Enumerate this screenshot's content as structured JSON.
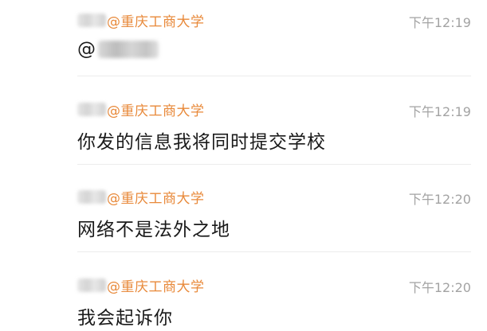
{
  "messages": [
    {
      "sender_org": "@重庆工商大学",
      "time": "下午12:19",
      "mention_prefix": "@",
      "text": ""
    },
    {
      "sender_org": "@重庆工商大学",
      "time": "下午12:19",
      "text": "你发的信息我将同时提交学校"
    },
    {
      "sender_org": "@重庆工商大学",
      "time": "下午12:20",
      "text": "网络不是法外之地"
    },
    {
      "sender_org": "@重庆工商大学",
      "time": "下午12:20",
      "text": "我会起诉你"
    }
  ],
  "colors": {
    "sender": "#e8893a",
    "timestamp": "#a3a3a3",
    "text": "#1a1a1a",
    "divider": "#ececec"
  }
}
